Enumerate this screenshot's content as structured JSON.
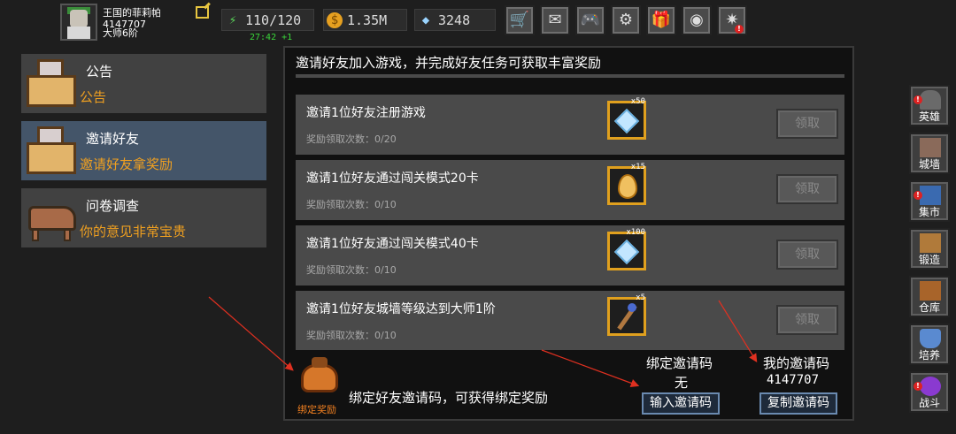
{
  "player": {
    "name": "王国的菲莉帕",
    "id": "4147707",
    "rank": "大师6阶"
  },
  "stats": {
    "energy": "110/120",
    "energy_timer": "27:42 +1",
    "gold": "1.35M",
    "gems": "3248"
  },
  "toolbar": {
    "icons": [
      "shop-cart-icon",
      "mail-icon",
      "gamepad-icon",
      "gear-icon",
      "gift-icon",
      "color-wheel-icon",
      "fireworks-icon"
    ]
  },
  "nav": {
    "items": [
      {
        "title": "公告",
        "subtitle": "公告"
      },
      {
        "title": "邀请好友",
        "subtitle": "邀请好友拿奖励"
      },
      {
        "title": "问卷调查",
        "subtitle": "你的意见非常宝贵"
      }
    ],
    "active_index": 1
  },
  "main": {
    "header": "邀请好友加入游戏，并完成好友任务可获取丰富奖励",
    "tasks": [
      {
        "title": "邀请1位好友注册游戏",
        "progress": "奖励领取次数：0/20",
        "reward": "diamond-icon",
        "reward_count": "x50",
        "button": "领取"
      },
      {
        "title": "邀请1位好友通过闯关模式20卡",
        "progress": "奖励领取次数：0/10",
        "reward": "egg-icon",
        "reward_count": "x15",
        "button": "领取"
      },
      {
        "title": "邀请1位好友通过闯关模式40卡",
        "progress": "奖励领取次数：0/10",
        "reward": "diamond-icon",
        "reward_count": "x100",
        "button": "领取"
      },
      {
        "title": "邀请1位好友城墙等级达到大师1阶",
        "progress": "奖励领取次数：0/10",
        "reward": "staff-icon",
        "reward_count": "x5",
        "button": "领取"
      }
    ],
    "bottom": {
      "icon_label": "绑定奖励",
      "bind_text": "绑定好友邀请码，可获得绑定奖励",
      "bind_title": "绑定邀请码",
      "bind_value": "无",
      "enter_button": "输入邀请码",
      "my_code_title": "我的邀请码",
      "my_code_value": "4147707",
      "copy_button": "复制邀请码"
    }
  },
  "side": {
    "items": [
      {
        "label": "英雄",
        "alert": true
      },
      {
        "label": "城墙",
        "alert": false
      },
      {
        "label": "集市",
        "alert": true
      },
      {
        "label": "锻造",
        "alert": false
      },
      {
        "label": "仓库",
        "alert": false
      },
      {
        "label": "培养",
        "alert": false
      },
      {
        "label": "战斗",
        "alert": true
      }
    ]
  },
  "colors": {
    "accent_orange": "#f0a020",
    "active_nav": "#445569",
    "annotation_arrow": "#e03020",
    "timer_green": "#3ad63a"
  }
}
